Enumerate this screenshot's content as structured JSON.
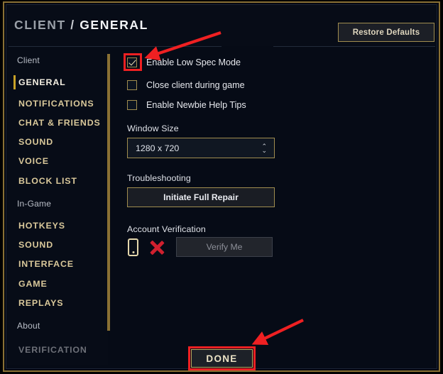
{
  "window": {
    "title_breadcrumb": {
      "parent": "CLIENT",
      "separator": "/",
      "current": "GENERAL"
    },
    "restore_defaults_label": "Restore Defaults",
    "accent_gold": "#c9a227",
    "frame_gold": "#8a7134",
    "background": "#060b16",
    "annotation_red": "#ef2022"
  },
  "sidebar": {
    "groups": [
      {
        "label": "Client",
        "items": [
          {
            "label": "GENERAL",
            "active": true
          },
          {
            "label": "NOTIFICATIONS",
            "active": false
          },
          {
            "label": "CHAT & FRIENDS",
            "active": false
          },
          {
            "label": "SOUND",
            "active": false
          },
          {
            "label": "VOICE",
            "active": false
          },
          {
            "label": "BLOCK LIST",
            "active": false
          }
        ]
      },
      {
        "label": "In-Game",
        "items": [
          {
            "label": "HOTKEYS",
            "active": false
          },
          {
            "label": "SOUND",
            "active": false
          },
          {
            "label": "INTERFACE",
            "active": false
          },
          {
            "label": "GAME",
            "active": false
          },
          {
            "label": "REPLAYS",
            "active": false
          }
        ]
      },
      {
        "label": "About",
        "items": [
          {
            "label": "VERIFICATION",
            "active": false
          }
        ]
      }
    ]
  },
  "main": {
    "checkboxes": [
      {
        "label": "Enable Low Spec Mode",
        "checked": true,
        "highlighted": true
      },
      {
        "label": "Close client during game",
        "checked": false,
        "highlighted": false
      },
      {
        "label": "Enable Newbie Help Tips",
        "checked": false,
        "highlighted": false
      }
    ],
    "window_size": {
      "section_label": "Window Size",
      "selected_value": "1280 x 720",
      "up_arrow": "⌃",
      "down_arrow": "⌄"
    },
    "troubleshooting": {
      "section_label": "Troubleshooting",
      "button_label": "Initiate Full Repair"
    },
    "account_verification": {
      "section_label": "Account Verification",
      "status_icon": "phone-icon",
      "status_mark": "red-x-icon",
      "button_label": "Verify Me",
      "button_disabled": true
    }
  },
  "footer": {
    "done_label": "DONE",
    "done_highlighted": true
  }
}
